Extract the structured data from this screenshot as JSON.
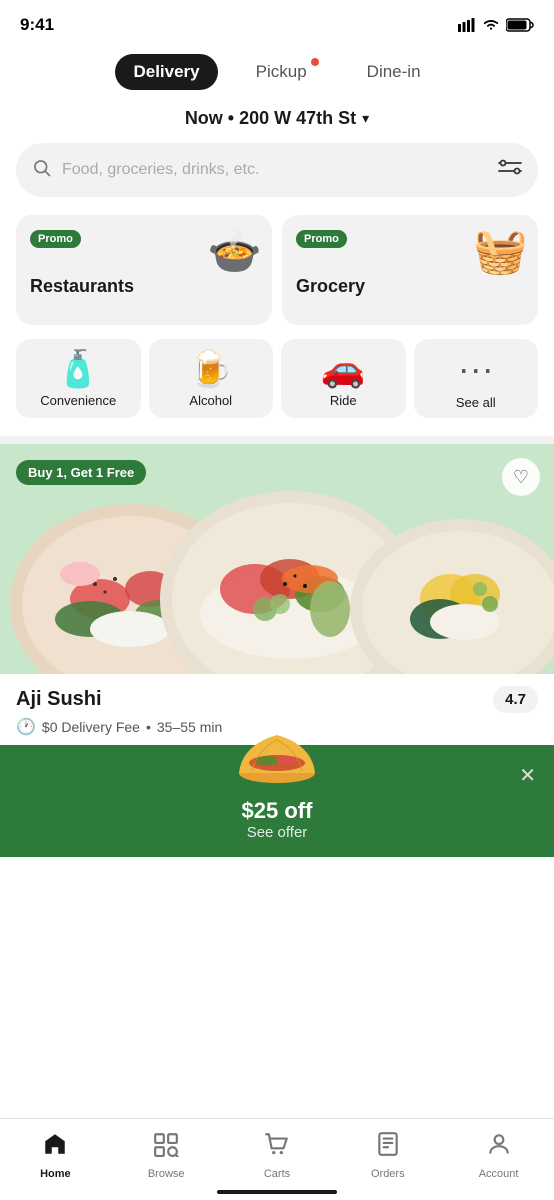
{
  "statusBar": {
    "time": "9:41"
  },
  "tabs": [
    {
      "id": "delivery",
      "label": "Delivery",
      "active": true,
      "hasDot": false
    },
    {
      "id": "pickup",
      "label": "Pickup",
      "active": false,
      "hasDot": true
    },
    {
      "id": "dine-in",
      "label": "Dine-in",
      "active": false,
      "hasDot": false
    }
  ],
  "address": {
    "text": "Now • 200 W 47th St",
    "chevron": "▾"
  },
  "search": {
    "placeholder": "Food, groceries, drinks, etc."
  },
  "categoriesLarge": [
    {
      "id": "restaurants",
      "label": "Restaurants",
      "promo": true,
      "emoji": "🍲"
    },
    {
      "id": "grocery",
      "label": "Grocery",
      "promo": true,
      "emoji": "🧺"
    }
  ],
  "categoriesSmall": [
    {
      "id": "convenience",
      "label": "Convenience",
      "emoji": "🧴"
    },
    {
      "id": "alcohol",
      "label": "Alcohol",
      "emoji": "🍺"
    },
    {
      "id": "ride",
      "label": "Ride",
      "emoji": "🚗"
    },
    {
      "id": "see-all",
      "label": "See all",
      "emoji": "..."
    }
  ],
  "promo": {
    "badge": "Promo",
    "deal": "Buy 1, Get 1 Free"
  },
  "restaurant": {
    "name": "Aji Sushi",
    "rating": "4.7",
    "deliveryFee": "$0 Delivery Fee",
    "time": "35–55 min",
    "dealBadge": "Buy 1, Get 1 Free"
  },
  "bottomBanner": {
    "title": "$25 off",
    "subtitle": "See offer"
  },
  "bottomNav": [
    {
      "id": "home",
      "label": "Home",
      "icon": "🏠",
      "active": true
    },
    {
      "id": "browse",
      "label": "Browse",
      "icon": "🔍",
      "active": false
    },
    {
      "id": "carts",
      "label": "Carts",
      "icon": "🛒",
      "active": false
    },
    {
      "id": "orders",
      "label": "Orders",
      "icon": "📋",
      "active": false
    },
    {
      "id": "account",
      "label": "Account",
      "icon": "👤",
      "active": false
    }
  ]
}
